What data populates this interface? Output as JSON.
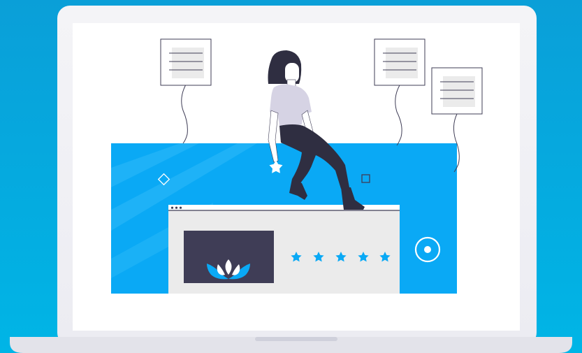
{
  "colors": {
    "background_top": "#0a9fd8",
    "background_bottom": "#00b3e3",
    "laptop_frame": "#f2f2f6",
    "laptop_base": "#e4e4ec",
    "screen": "#ffffff",
    "accent_blue": "#0aa9f5",
    "panel_light": "#ebebeb",
    "dark_slate": "#3f3d56",
    "person_shirt": "#d6d3e4",
    "person_pants": "#2f2e41"
  },
  "illustration": {
    "window_dots": 3,
    "rating": {
      "filled_stars": 5,
      "total_stars": 5
    },
    "document_cards": 3
  }
}
